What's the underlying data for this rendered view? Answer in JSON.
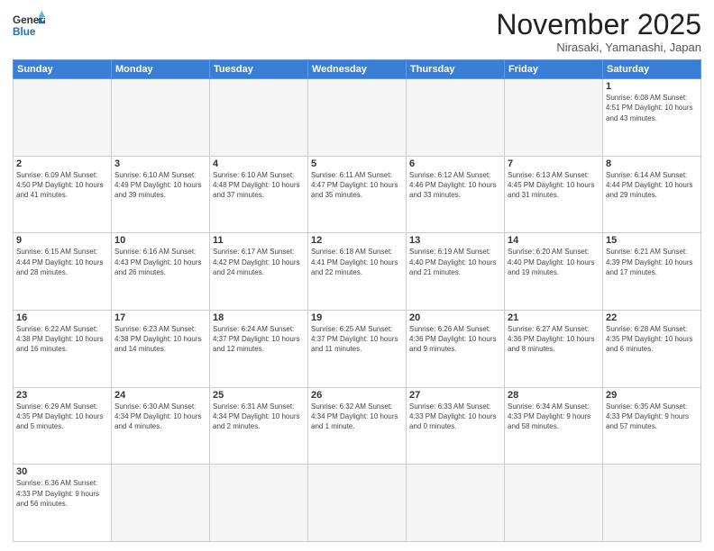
{
  "header": {
    "logo_general": "General",
    "logo_blue": "Blue",
    "title": "November 2025",
    "subtitle": "Nirasaki, Yamanashi, Japan"
  },
  "weekdays": [
    "Sunday",
    "Monday",
    "Tuesday",
    "Wednesday",
    "Thursday",
    "Friday",
    "Saturday"
  ],
  "weeks": [
    [
      {
        "day": "",
        "info": ""
      },
      {
        "day": "",
        "info": ""
      },
      {
        "day": "",
        "info": ""
      },
      {
        "day": "",
        "info": ""
      },
      {
        "day": "",
        "info": ""
      },
      {
        "day": "",
        "info": ""
      },
      {
        "day": "1",
        "info": "Sunrise: 6:08 AM\nSunset: 4:51 PM\nDaylight: 10 hours and 43 minutes."
      }
    ],
    [
      {
        "day": "2",
        "info": "Sunrise: 6:09 AM\nSunset: 4:50 PM\nDaylight: 10 hours and 41 minutes."
      },
      {
        "day": "3",
        "info": "Sunrise: 6:10 AM\nSunset: 4:49 PM\nDaylight: 10 hours and 39 minutes."
      },
      {
        "day": "4",
        "info": "Sunrise: 6:10 AM\nSunset: 4:48 PM\nDaylight: 10 hours and 37 minutes."
      },
      {
        "day": "5",
        "info": "Sunrise: 6:11 AM\nSunset: 4:47 PM\nDaylight: 10 hours and 35 minutes."
      },
      {
        "day": "6",
        "info": "Sunrise: 6:12 AM\nSunset: 4:46 PM\nDaylight: 10 hours and 33 minutes."
      },
      {
        "day": "7",
        "info": "Sunrise: 6:13 AM\nSunset: 4:45 PM\nDaylight: 10 hours and 31 minutes."
      },
      {
        "day": "8",
        "info": "Sunrise: 6:14 AM\nSunset: 4:44 PM\nDaylight: 10 hours and 29 minutes."
      }
    ],
    [
      {
        "day": "9",
        "info": "Sunrise: 6:15 AM\nSunset: 4:44 PM\nDaylight: 10 hours and 28 minutes."
      },
      {
        "day": "10",
        "info": "Sunrise: 6:16 AM\nSunset: 4:43 PM\nDaylight: 10 hours and 26 minutes."
      },
      {
        "day": "11",
        "info": "Sunrise: 6:17 AM\nSunset: 4:42 PM\nDaylight: 10 hours and 24 minutes."
      },
      {
        "day": "12",
        "info": "Sunrise: 6:18 AM\nSunset: 4:41 PM\nDaylight: 10 hours and 22 minutes."
      },
      {
        "day": "13",
        "info": "Sunrise: 6:19 AM\nSunset: 4:40 PM\nDaylight: 10 hours and 21 minutes."
      },
      {
        "day": "14",
        "info": "Sunrise: 6:20 AM\nSunset: 4:40 PM\nDaylight: 10 hours and 19 minutes."
      },
      {
        "day": "15",
        "info": "Sunrise: 6:21 AM\nSunset: 4:39 PM\nDaylight: 10 hours and 17 minutes."
      }
    ],
    [
      {
        "day": "16",
        "info": "Sunrise: 6:22 AM\nSunset: 4:38 PM\nDaylight: 10 hours and 16 minutes."
      },
      {
        "day": "17",
        "info": "Sunrise: 6:23 AM\nSunset: 4:38 PM\nDaylight: 10 hours and 14 minutes."
      },
      {
        "day": "18",
        "info": "Sunrise: 6:24 AM\nSunset: 4:37 PM\nDaylight: 10 hours and 12 minutes."
      },
      {
        "day": "19",
        "info": "Sunrise: 6:25 AM\nSunset: 4:37 PM\nDaylight: 10 hours and 11 minutes."
      },
      {
        "day": "20",
        "info": "Sunrise: 6:26 AM\nSunset: 4:36 PM\nDaylight: 10 hours and 9 minutes."
      },
      {
        "day": "21",
        "info": "Sunrise: 6:27 AM\nSunset: 4:36 PM\nDaylight: 10 hours and 8 minutes."
      },
      {
        "day": "22",
        "info": "Sunrise: 6:28 AM\nSunset: 4:35 PM\nDaylight: 10 hours and 6 minutes."
      }
    ],
    [
      {
        "day": "23",
        "info": "Sunrise: 6:29 AM\nSunset: 4:35 PM\nDaylight: 10 hours and 5 minutes."
      },
      {
        "day": "24",
        "info": "Sunrise: 6:30 AM\nSunset: 4:34 PM\nDaylight: 10 hours and 4 minutes."
      },
      {
        "day": "25",
        "info": "Sunrise: 6:31 AM\nSunset: 4:34 PM\nDaylight: 10 hours and 2 minutes."
      },
      {
        "day": "26",
        "info": "Sunrise: 6:32 AM\nSunset: 4:34 PM\nDaylight: 10 hours and 1 minute."
      },
      {
        "day": "27",
        "info": "Sunrise: 6:33 AM\nSunset: 4:33 PM\nDaylight: 10 hours and 0 minutes."
      },
      {
        "day": "28",
        "info": "Sunrise: 6:34 AM\nSunset: 4:33 PM\nDaylight: 9 hours and 58 minutes."
      },
      {
        "day": "29",
        "info": "Sunrise: 6:35 AM\nSunset: 4:33 PM\nDaylight: 9 hours and 57 minutes."
      }
    ],
    [
      {
        "day": "30",
        "info": "Sunrise: 6:36 AM\nSunset: 4:33 PM\nDaylight: 9 hours and 56 minutes."
      },
      {
        "day": "",
        "info": ""
      },
      {
        "day": "",
        "info": ""
      },
      {
        "day": "",
        "info": ""
      },
      {
        "day": "",
        "info": ""
      },
      {
        "day": "",
        "info": ""
      },
      {
        "day": "",
        "info": ""
      }
    ]
  ]
}
